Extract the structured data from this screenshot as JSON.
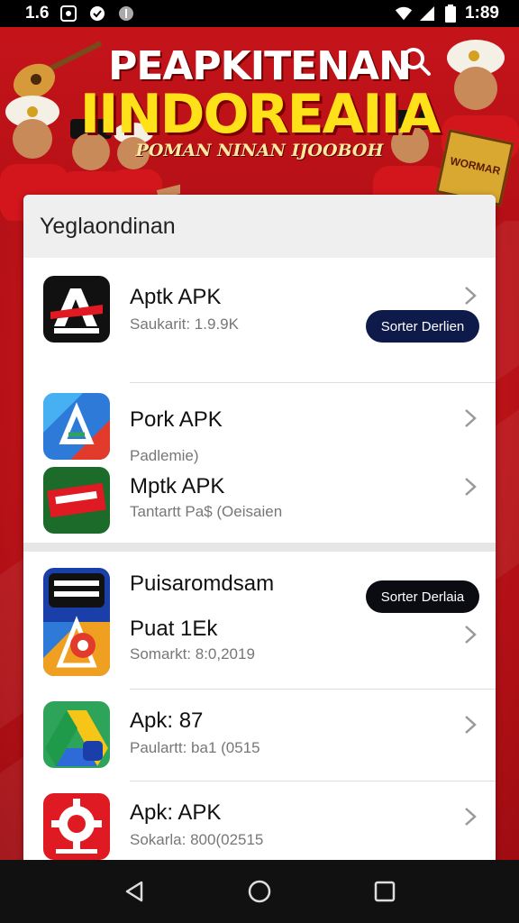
{
  "status_bar": {
    "left_text": "1.6",
    "time": "1:89"
  },
  "banner": {
    "title_line_1": "PEAPKITENAN",
    "title_line_2": "IINDOREAIIA",
    "subtitle": "POMAN NINAN IJOOBOH",
    "sign_text": "WORMAR",
    "accent_colors": {
      "red": "#c4141a",
      "yellow": "#ffe11a"
    }
  },
  "card": {
    "header": "Yeglaondinan",
    "items": [
      {
        "title": "Aptk APK",
        "subtitle": "Saukarit: 1.9.9K",
        "icon": "a3-logo-icon",
        "button": "Sorter Derlien"
      },
      {
        "title": "Pork APK",
        "subtitle": "Padlemie)",
        "icon": "triangle-map-icon"
      },
      {
        "title": "Mptk APK",
        "subtitle": "Tantartt Pa$ (Oeisaien",
        "icon": "green-badge-icon"
      },
      {
        "title": "Puisaromdsam",
        "subtitle": "",
        "icon": "puzzle-badge-icon",
        "button": "Sorter Derlaia"
      },
      {
        "title": "Puat 1Ek",
        "subtitle": "Somarkt: 8:0,2019",
        "icon": ""
      },
      {
        "title": "Apk: 87",
        "subtitle": "Paulartt: ba1 (0515",
        "icon": "drive-triangle-icon"
      },
      {
        "title": "Apk: APK",
        "subtitle": "Sokarla: 800(02515",
        "icon": "gear-app-icon"
      }
    ],
    "button_colors": {
      "dark_blue": "#0e1a4a",
      "black": "#0b0b12"
    }
  }
}
